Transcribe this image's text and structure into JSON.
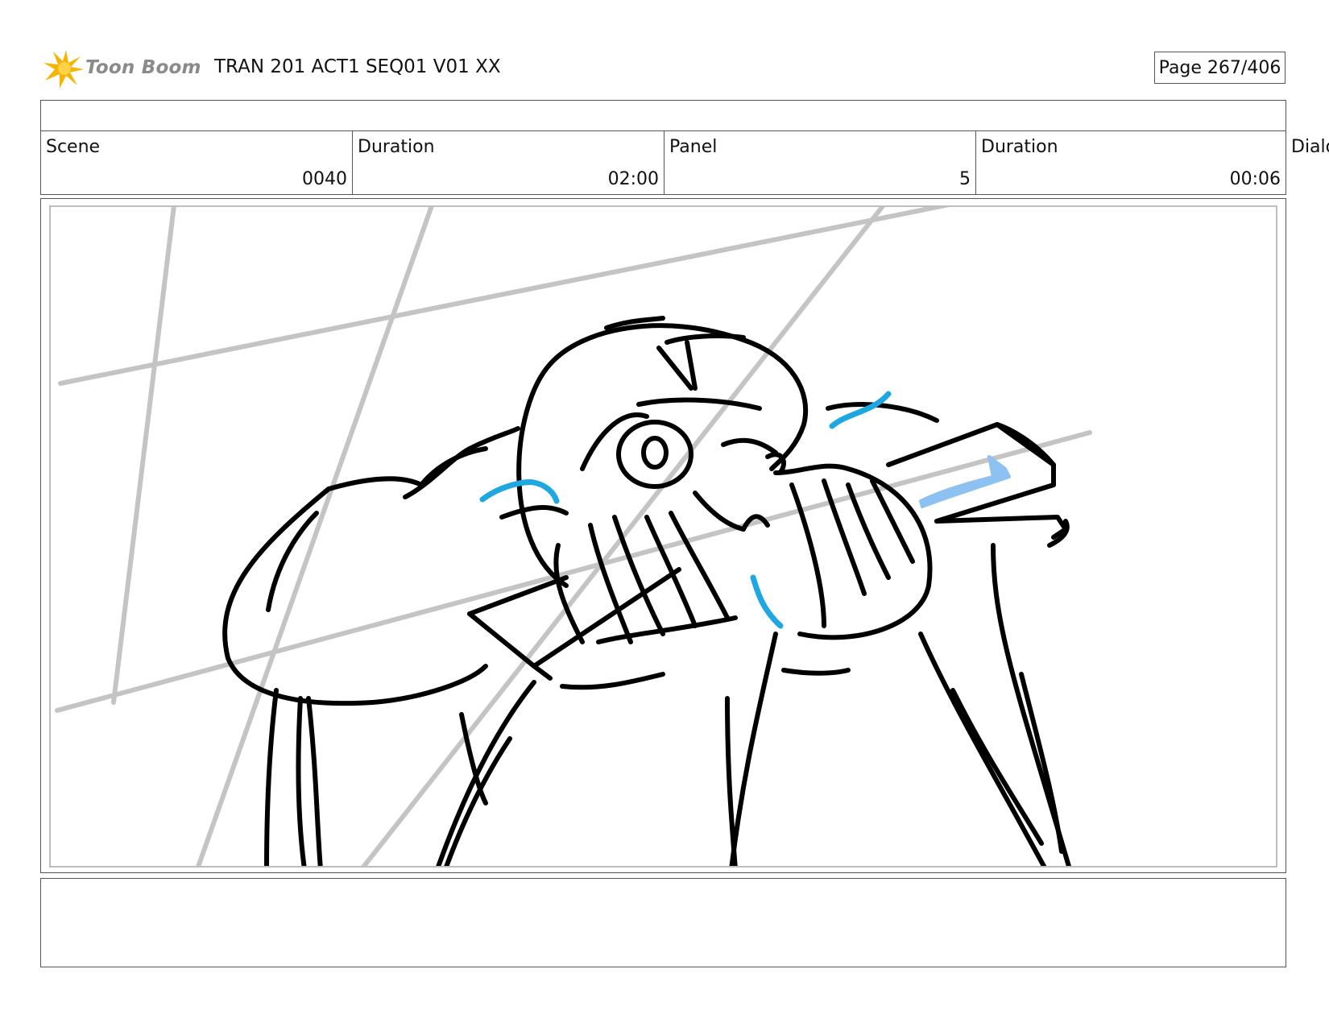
{
  "header": {
    "logo_text": "Toon Boom",
    "doc_title": "TRAN 201 ACT1 SEQ01 V01 XX",
    "page_label": "Page 267/406"
  },
  "info": {
    "scene_label": "Scene",
    "scene_value": "0040",
    "scene_duration_label": "Duration",
    "scene_duration_value": "02:00",
    "panel_label": "Panel",
    "panel_value": "5",
    "panel_duration_label": "Duration",
    "panel_duration_value": "00:06",
    "dialog_label": "Dialog"
  },
  "colors": {
    "logo_star": "#f5b400",
    "sketch_line": "#000000",
    "guide_line": "#c4c4c4",
    "accent_blue": "#1ea7e1",
    "accent_light_blue": "#8cc1f2"
  },
  "icons": {
    "logo": "toon-boom-star-icon"
  }
}
